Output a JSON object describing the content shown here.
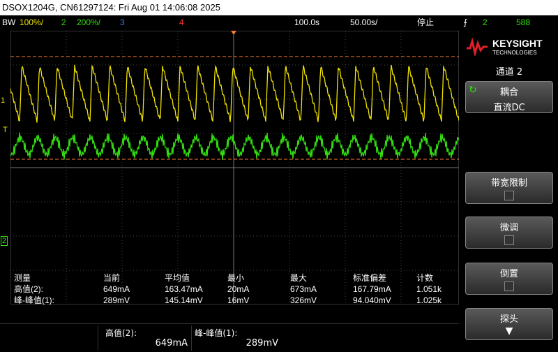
{
  "title_bar": "DSOX1204G, CN61297124: Fri Aug 01 14:06:08 2025",
  "status": {
    "bw": "BW",
    "ch1_scale": "100%/",
    "ch2_label": "2",
    "ch2_scale": "200%/",
    "ch3_label": "3",
    "ch4_label": "4",
    "timebase": "100.0s",
    "delay": "50.00s/",
    "run_state": "停止",
    "trigger_icon": "trigger-edge-icon",
    "trigger_channel": "2",
    "trigger_level": "588"
  },
  "markers": {
    "ch1": "1",
    "trigger": "T",
    "ch2": "2"
  },
  "measurements": {
    "headers": [
      "测量",
      "当前",
      "平均值",
      "最小",
      "最大",
      "标准偏差",
      "计数"
    ],
    "rows": [
      [
        "高值(2):",
        "649mA",
        "163.47mA",
        "20mA",
        "673mA",
        "167.79mA",
        "1.051k"
      ],
      [
        "峰-峰值(1):",
        "289mV",
        "145.14mV",
        "16mV",
        "326mV",
        "94.040mV",
        "1.025k"
      ]
    ]
  },
  "bottom": {
    "box1_label": "高值(2):",
    "box1_value": "649mA",
    "box2_label": "峰-峰值(1):",
    "box2_value": "289mV"
  },
  "sidebar": {
    "brand": "KEYSIGHT",
    "brand_sub": "TECHNOLOGIES",
    "menu_title": "通道 2",
    "coupling_label": "耦合",
    "coupling_value": "直流DC",
    "bw_limit_label": "带宽限制",
    "fine_label": "微调",
    "invert_label": "倒置",
    "probe_label": "探头"
  },
  "colors": {
    "ch1": "#f2e400",
    "ch2": "#33dd11",
    "ch3": "#3d7bff",
    "ch4": "#ff3333",
    "cursor": "#ff7a30",
    "grid": "#444444"
  }
}
